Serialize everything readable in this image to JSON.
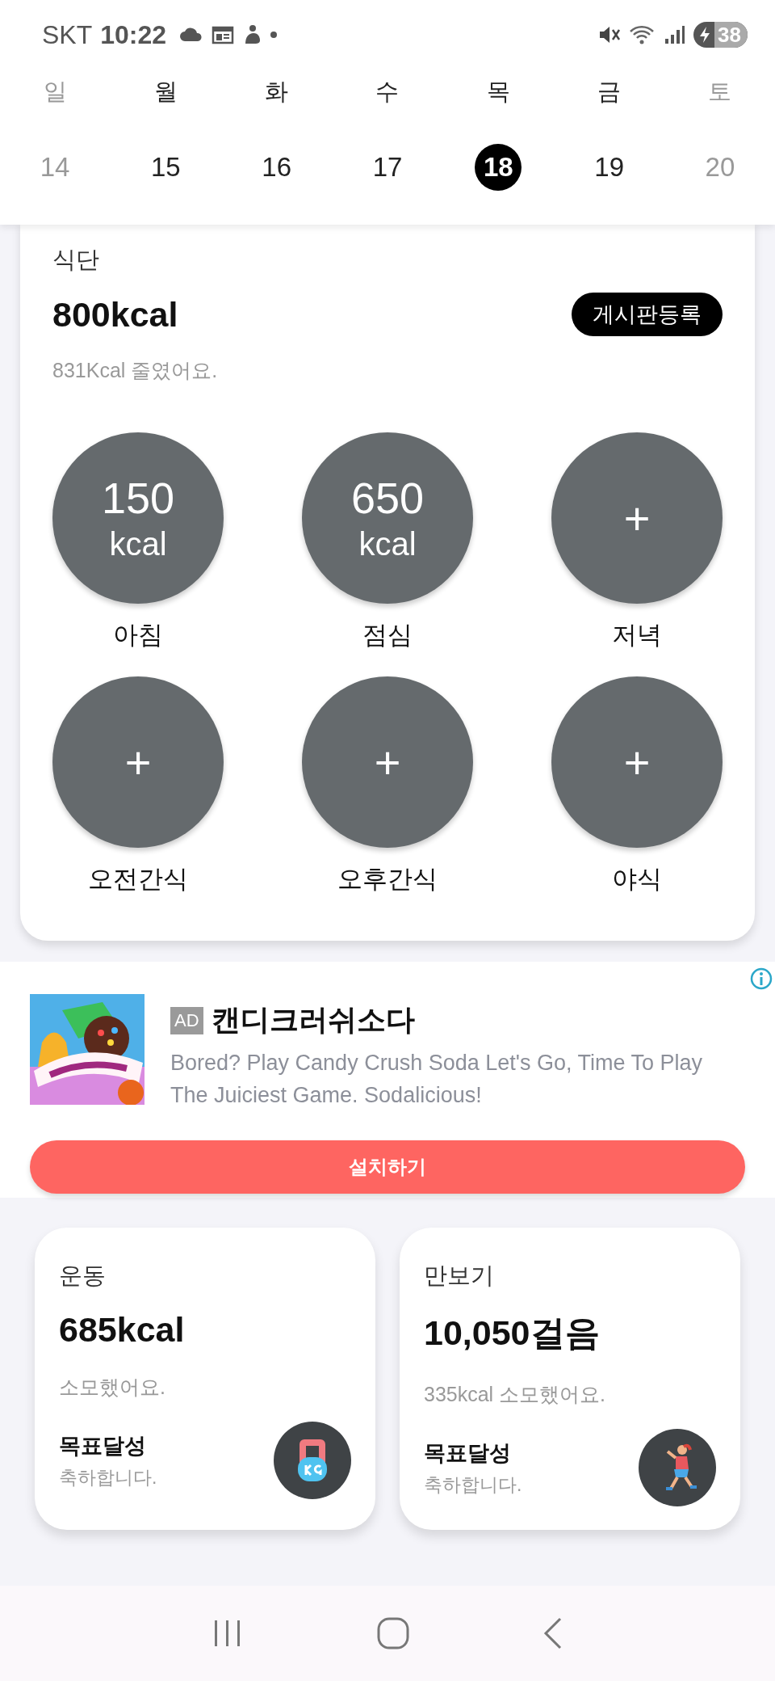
{
  "status_bar": {
    "carrier": "SKT",
    "time": "10:22",
    "battery": "38"
  },
  "week": [
    {
      "weekday": "일",
      "date": "14",
      "selected": false,
      "weekend": true
    },
    {
      "weekday": "월",
      "date": "15",
      "selected": false,
      "weekend": false
    },
    {
      "weekday": "화",
      "date": "16",
      "selected": false,
      "weekend": false
    },
    {
      "weekday": "수",
      "date": "17",
      "selected": false,
      "weekend": false
    },
    {
      "weekday": "목",
      "date": "18",
      "selected": true,
      "weekend": false
    },
    {
      "weekday": "금",
      "date": "19",
      "selected": false,
      "weekend": false
    },
    {
      "weekday": "토",
      "date": "20",
      "selected": false,
      "weekend": true
    }
  ],
  "diet": {
    "title": "식단",
    "total": "800kcal",
    "button": "게시판등록",
    "note": "831Kcal 줄였어요.",
    "meals": [
      {
        "kind": "logged",
        "value": "150",
        "unit": "kcal",
        "name": "아침"
      },
      {
        "kind": "logged",
        "value": "650",
        "unit": "kcal",
        "name": "점심"
      },
      {
        "kind": "add",
        "symbol": "+",
        "name": "저녁"
      },
      {
        "kind": "add",
        "symbol": "+",
        "name": "오전간식"
      },
      {
        "kind": "add",
        "symbol": "+",
        "name": "오후간식"
      },
      {
        "kind": "add",
        "symbol": "+",
        "name": "야식"
      }
    ]
  },
  "ad": {
    "badge": "AD",
    "title": "캔디크러쉬소다",
    "description": "Bored? Play Candy Crush Soda Let's Go, Time To Play The Juiciest Game. Sodalicious!",
    "button": "설치하기"
  },
  "cards": [
    {
      "kind": "exercise",
      "title": "운동",
      "value": "685kcal",
      "note": "소모했어요.",
      "goal": "목표달성",
      "goal_note": "축하합니다."
    },
    {
      "kind": "steps",
      "title": "만보기",
      "value": "10,050걸음",
      "note": "335kcal 소모했어요.",
      "goal": "목표달성",
      "goal_note": "축하합니다."
    }
  ]
}
